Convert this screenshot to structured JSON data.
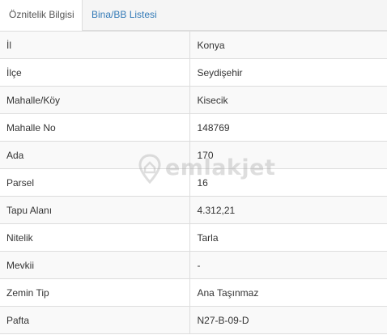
{
  "tabs": [
    {
      "label": "Öznitelik Bilgisi",
      "active": true
    },
    {
      "label": "Bina/BB Listesi",
      "active": false
    }
  ],
  "rows": [
    {
      "key": "İl",
      "value": "Konya"
    },
    {
      "key": "İlçe",
      "value": "Seydişehir"
    },
    {
      "key": "Mahalle/Köy",
      "value": "Kisecik"
    },
    {
      "key": "Mahalle No",
      "value": "148769"
    },
    {
      "key": "Ada",
      "value": "170"
    },
    {
      "key": "Parsel",
      "value": "16"
    },
    {
      "key": "Tapu Alanı",
      "value": "4.312,21"
    },
    {
      "key": "Nitelik",
      "value": "Tarla"
    },
    {
      "key": "Mevkii",
      "value": "-"
    },
    {
      "key": "Zemin Tip",
      "value": "Ana Taşınmaz"
    },
    {
      "key": "Pafta",
      "value": "N27-B-09-D"
    }
  ],
  "watermark": {
    "text": "emlakjet",
    "icon": "location-pin-icon"
  },
  "colors": {
    "link": "#337ab7",
    "border": "#dddddd",
    "stripe": "#f9f9f9"
  }
}
